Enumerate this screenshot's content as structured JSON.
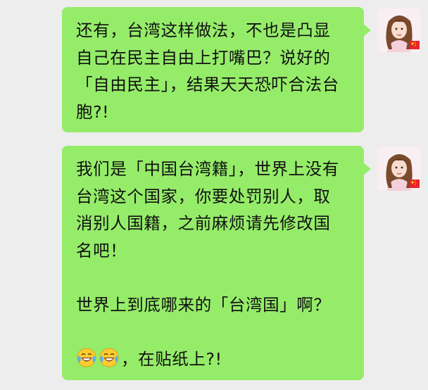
{
  "messages": [
    {
      "lines": [
        "还有，台湾这样做法，不也是凸显",
        "自己在民主自由上打嘴巴？说好的",
        "「自由民主」，结果天天恐吓合法台",
        "胞?!"
      ]
    },
    {
      "lines": [
        "我们是「中国台湾籍」，世界上没有",
        "台湾这个国家，你要处罚别人，取",
        "消别人国籍，之前麻烦请先修改国",
        "名吧！",
        "",
        "世界上到底哪来的「台湾国」啊？",
        "",
        "，在贴纸上?!"
      ],
      "leading_emoji": [
        "laughing-crying-emoji",
        "laughing-crying-emoji"
      ]
    }
  ],
  "colors": {
    "background": "#ededed",
    "bubble": "#95ec69",
    "text": "#111111",
    "flag_red": "#e8232a"
  }
}
